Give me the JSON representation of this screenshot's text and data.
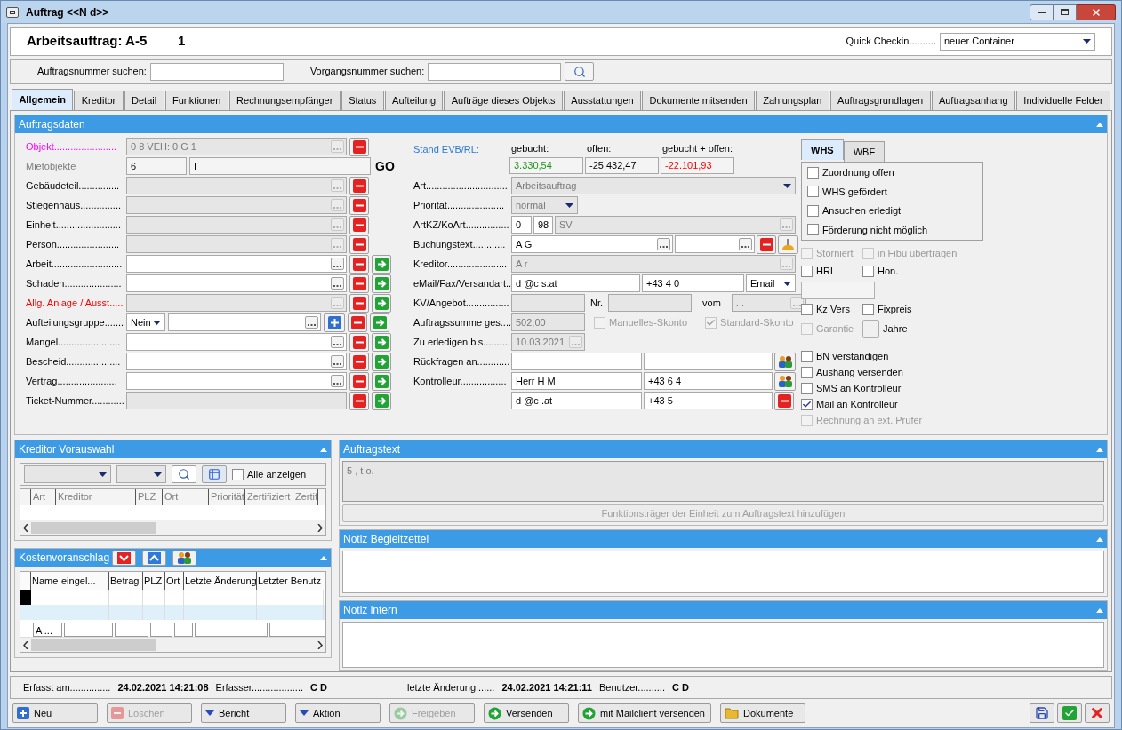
{
  "window": {
    "title": "Auftrag <<N d>>"
  },
  "header": {
    "title": "Arbeitsauftrag: A-5",
    "number": "1",
    "quick_checkin": {
      "label": "Quick Checkin..........",
      "value": "neuer Container"
    }
  },
  "search": [
    {
      "label": "Auftragsnummer suchen:"
    },
    {
      "label": "Vorgangsnummer suchen:"
    }
  ],
  "tabs": [
    {
      "label": "Allgemein",
      "selected": true
    },
    {
      "label": "Kreditor",
      "selected": false
    },
    {
      "label": "Detail",
      "selected": false
    },
    {
      "label": "Funktionen",
      "selected": false
    },
    {
      "label": "Rechnungsempfänger",
      "selected": false
    },
    {
      "label": "Status",
      "selected": false
    },
    {
      "label": "Aufteilung",
      "selected": false
    },
    {
      "label": "Aufträge dieses Objekts",
      "selected": false
    },
    {
      "label": "Ausstattungen",
      "selected": false
    },
    {
      "label": "Dokumente mitsenden",
      "selected": false
    },
    {
      "label": "Zahlungsplan",
      "selected": false
    },
    {
      "label": "Auftragsgrundlagen",
      "selected": false
    },
    {
      "label": "Auftragsanhang",
      "selected": false
    },
    {
      "label": "Individuelle Felder",
      "selected": false
    }
  ],
  "auftragsdaten": {
    "title": "Auftragsdaten",
    "left_rows": [
      {
        "kind": "lookup",
        "label": "Objekt.......................",
        "required": true,
        "inactive": false,
        "flagged": false,
        "value": "0 8 VEH: 0 G 1",
        "enabled": false,
        "linked": false
      },
      {
        "kind": "split",
        "label": "Mietobjekte",
        "required": false,
        "inactive": true,
        "flagged": false,
        "values": [
          "6",
          "I"
        ],
        "go": "GO"
      },
      {
        "kind": "lookup",
        "label": "Gebäudeteil...............",
        "required": false,
        "inactive": false,
        "flagged": false,
        "enabled": false,
        "linked": false
      },
      {
        "kind": "lookup",
        "label": "Stiegenhaus...............",
        "required": false,
        "inactive": false,
        "flagged": false,
        "enabled": false,
        "linked": false
      },
      {
        "kind": "lookup",
        "label": "Einheit........................",
        "required": false,
        "inactive": false,
        "flagged": false,
        "enabled": false,
        "linked": false
      },
      {
        "kind": "lookup",
        "label": "Person.......................",
        "required": false,
        "inactive": false,
        "flagged": false,
        "enabled": false,
        "linked": false
      },
      {
        "kind": "lookup",
        "label": "Arbeit..........................",
        "required": false,
        "inactive": false,
        "flagged": false,
        "enabled": true,
        "linked": true
      },
      {
        "kind": "lookup",
        "label": "Schaden.....................",
        "required": false,
        "inactive": false,
        "flagged": false,
        "enabled": true,
        "linked": true
      },
      {
        "kind": "lookup",
        "label": "Allg. Anlage / Ausst.....",
        "required": false,
        "inactive": false,
        "flagged": true,
        "enabled": false,
        "linked": true
      },
      {
        "kind": "group",
        "label": "Aufteilungsgruppe.......",
        "required": false,
        "inactive": false,
        "flagged": false,
        "choice": "Nein",
        "enabled": true,
        "linked": true
      },
      {
        "kind": "lookup",
        "label": "Mangel.......................",
        "required": false,
        "inactive": false,
        "flagged": false,
        "enabled": true,
        "linked": true
      },
      {
        "kind": "lookup",
        "label": "Bescheid....................",
        "required": false,
        "inactive": false,
        "flagged": false,
        "enabled": true,
        "linked": true
      },
      {
        "kind": "lookup",
        "label": "Vertrag......................",
        "required": false,
        "inactive": false,
        "flagged": false,
        "enabled": true,
        "linked": true
      },
      {
        "kind": "plain",
        "label": "Ticket-Nummer............",
        "required": false,
        "inactive": false,
        "flagged": false,
        "enabled": false,
        "linked": true
      }
    ],
    "stand": {
      "label": "Stand EVB/RL:",
      "amounts": [
        {
          "label": "gebucht:",
          "value": "3.330,54",
          "color": "#1e9a1e"
        },
        {
          "label": "offen:",
          "value": "-25.432,47",
          "color": "#000000"
        },
        {
          "label": "gebucht + offen:",
          "value": "-22.101,93",
          "color": "#ff0000"
        }
      ]
    },
    "art": {
      "label": "Art..............................",
      "value": "Arbeitsauftrag"
    },
    "prioritaet": {
      "label": "Priorität.....................",
      "value": "normal"
    },
    "artkz": {
      "label": "ArtKZ/KoArt................",
      "values": [
        "0",
        "98",
        "SV"
      ]
    },
    "buchungstext": {
      "label": "Buchungstext............",
      "value": "A G"
    },
    "kreditor": {
      "label": "Kreditor......................",
      "value": "A r"
    },
    "email": {
      "label": "eMail/Fax/Versandart..",
      "values": [
        "d @c s.at",
        "+43 4 0"
      ],
      "mode": "Email"
    },
    "kv": {
      "label": "KV/Angebot................",
      "nr_label": "Nr.",
      "vom_label": "vom",
      "date": ". ."
    },
    "summe": {
      "label": "Auftragssumme ges....",
      "value": "502,00",
      "checks": [
        {
          "label": "Manuelles-Skonto",
          "checked": false
        },
        {
          "label": "Standard-Skonto",
          "checked": true
        }
      ]
    },
    "erledigen": {
      "label": "Zu erledigen bis..........",
      "value": "10.03.2021"
    },
    "rueckfragen": {
      "label": "Rückfragen an............"
    },
    "kontrolleur": {
      "label": "Kontrolleur.................",
      "values": [
        "Herr H M",
        "+43 6 4"
      ]
    },
    "kontrolleur_contact": {
      "values": [
        "d @c .at",
        "+43 5"
      ]
    },
    "foerder_tabs": [
      {
        "label": "WHS",
        "selected": true
      },
      {
        "label": "WBF",
        "selected": false
      }
    ],
    "foerder_checks": [
      {
        "label": "Zuordnung offen",
        "checked": false
      },
      {
        "label": "WHS gefördert",
        "checked": false
      },
      {
        "label": "Ansuchen erledigt",
        "checked": false
      },
      {
        "label": "Förderung nicht möglich",
        "checked": false
      }
    ],
    "flags": [
      {
        "kind": "pair",
        "items": [
          {
            "label": "Storniert",
            "checked": false,
            "enabled": false
          },
          {
            "label": "in Fibu übertragen",
            "checked": false,
            "enabled": false
          }
        ]
      },
      {
        "kind": "pair",
        "items": [
          {
            "label": "HRL",
            "checked": false,
            "enabled": true
          },
          {
            "label": "Hon.",
            "checked": false,
            "enabled": true
          }
        ]
      },
      {
        "kind": "field"
      },
      {
        "kind": "pair",
        "items": [
          {
            "label": "Kz Vers",
            "checked": false,
            "enabled": true
          },
          {
            "label": "Fixpreis",
            "checked": false,
            "enabled": true
          }
        ]
      },
      {
        "kind": "warranty",
        "items": [
          {
            "label": "Garantie",
            "checked": false,
            "enabled": false
          }
        ],
        "unit": "Jahre"
      }
    ],
    "notify": [
      {
        "label": "BN verständigen",
        "checked": false,
        "enabled": true
      },
      {
        "label": "Aushang versenden",
        "checked": false,
        "enabled": true
      },
      {
        "label": "SMS an Kontrolleur",
        "checked": false,
        "enabled": true
      },
      {
        "label": "Mail an Kontrolleur",
        "checked": true,
        "enabled": true
      },
      {
        "label": "Rechnung an ext. Prüfer",
        "checked": false,
        "enabled": false
      }
    ]
  },
  "kreditor_vorauswahl": {
    "title": "Kreditor Vorauswahl",
    "show_all": {
      "label": "Alle anzeigen",
      "checked": false
    },
    "columns": [
      "Art",
      "Kreditor",
      "PLZ",
      "Ort",
      "Priorität",
      "Zertifiziert",
      "Zertif"
    ]
  },
  "kostenvoranschlag": {
    "title": "Kostenvoranschlag",
    "columns": [
      "Name",
      "eingel...",
      "Betrag",
      "PLZ",
      "Ort",
      "Letzte Änderung",
      "Letzter Benutz"
    ],
    "rows": [
      {
        "current": true,
        "selected": false
      },
      {
        "current": false,
        "selected": true
      }
    ],
    "footer": [
      "A ..."
    ]
  },
  "auftragstext": {
    "title": "Auftragstext",
    "text": "5 , t o.",
    "action": "Funktionsträger der Einheit zum Auftragstext hinzufügen"
  },
  "notes": [
    {
      "title": "Notiz Begleitzettel"
    },
    {
      "title": "Notiz intern"
    }
  ],
  "status_bar": [
    {
      "label": "Erfasst am...............",
      "value": "24.02.2021 14:21:08"
    },
    {
      "label": "Erfasser...................",
      "value": "C D"
    },
    {
      "label": "letzte Änderung.......",
      "value": "24.02.2021 14:21:11"
    },
    {
      "label": "Benutzer..........",
      "value": "C D"
    }
  ],
  "buttons": [
    {
      "label": "Neu",
      "kind": "plus",
      "enabled": true
    },
    {
      "label": "Löschen",
      "kind": "minus",
      "enabled": false
    },
    {
      "label": "Bericht",
      "kind": "caret",
      "enabled": true
    },
    {
      "label": "Aktion",
      "kind": "caret",
      "enabled": true
    },
    {
      "label": "Freigeben",
      "kind": "arrow",
      "enabled": false
    },
    {
      "label": "Versenden",
      "kind": "arrow",
      "enabled": true
    },
    {
      "label": "mit Mailclient versenden",
      "kind": "arrow",
      "enabled": true
    },
    {
      "label": "Dokumente",
      "kind": "folder",
      "enabled": true
    }
  ]
}
